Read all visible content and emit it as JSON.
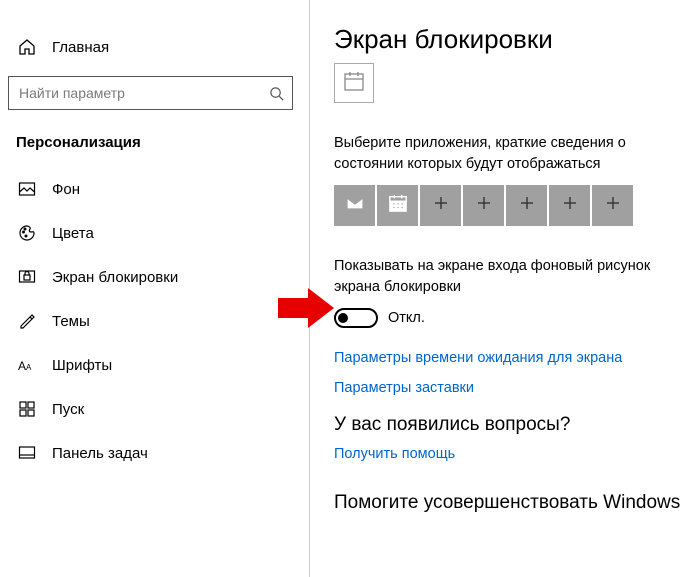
{
  "sidebar": {
    "home": "Главная",
    "searchPlaceholder": "Найти параметр",
    "section": "Персонализация",
    "items": [
      {
        "label": "Фон"
      },
      {
        "label": "Цвета"
      },
      {
        "label": "Экран блокировки"
      },
      {
        "label": "Темы"
      },
      {
        "label": "Шрифты"
      },
      {
        "label": "Пуск"
      },
      {
        "label": "Панель задач"
      }
    ]
  },
  "main": {
    "title": "Экран блокировки",
    "chooseAppsText": "Выберите приложения, краткие сведения о состоянии которых будут отображаться",
    "showBgText": "Показывать на экране входа фоновый рисунок экрана блокировки",
    "toggleState": "Откл.",
    "linkTimeout": "Параметры времени ожидания для экрана",
    "linkScreensaver": "Параметры заставки",
    "question": "У вас появились вопросы?",
    "getHelp": "Получить помощь",
    "improve": "Помогите усовершенствовать Windows",
    "tileIcons": [
      "mail-icon",
      "calendar-icon",
      "plus-icon",
      "plus-icon",
      "plus-icon",
      "plus-icon",
      "plus-icon"
    ]
  }
}
